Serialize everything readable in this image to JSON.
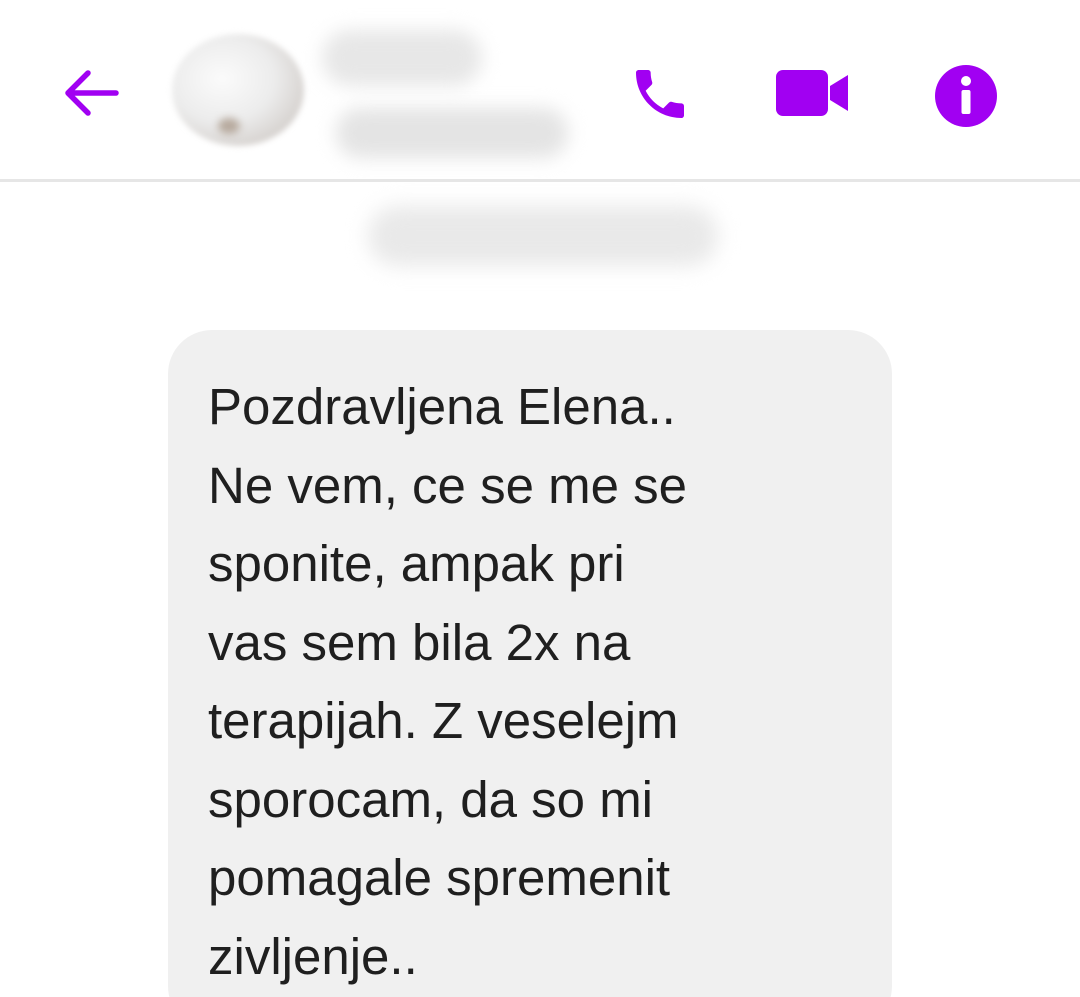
{
  "header": {
    "contact_name": "",
    "contact_status": "",
    "back_icon": "arrow-left-icon",
    "actions": [
      {
        "name": "call",
        "icon": "phone-icon"
      },
      {
        "name": "video",
        "icon": "video-camera-icon"
      },
      {
        "name": "info",
        "icon": "info-icon"
      }
    ]
  },
  "thread": {
    "timestamp": "",
    "messages": [
      {
        "direction": "incoming",
        "text": "Pozdravljena Elena..\nNe vem, ce se me se\nsponite, ampak pri\nvas sem bila 2x na\nterapijah. Z veselejm\nsporocam, da so mi\npomagale spremenit\nzivljenje.."
      }
    ]
  },
  "colors": {
    "accent": "#a100f2",
    "bubble_background": "#f0f0f0",
    "text": "#1f1f1f",
    "divider": "#e6e6e6"
  }
}
